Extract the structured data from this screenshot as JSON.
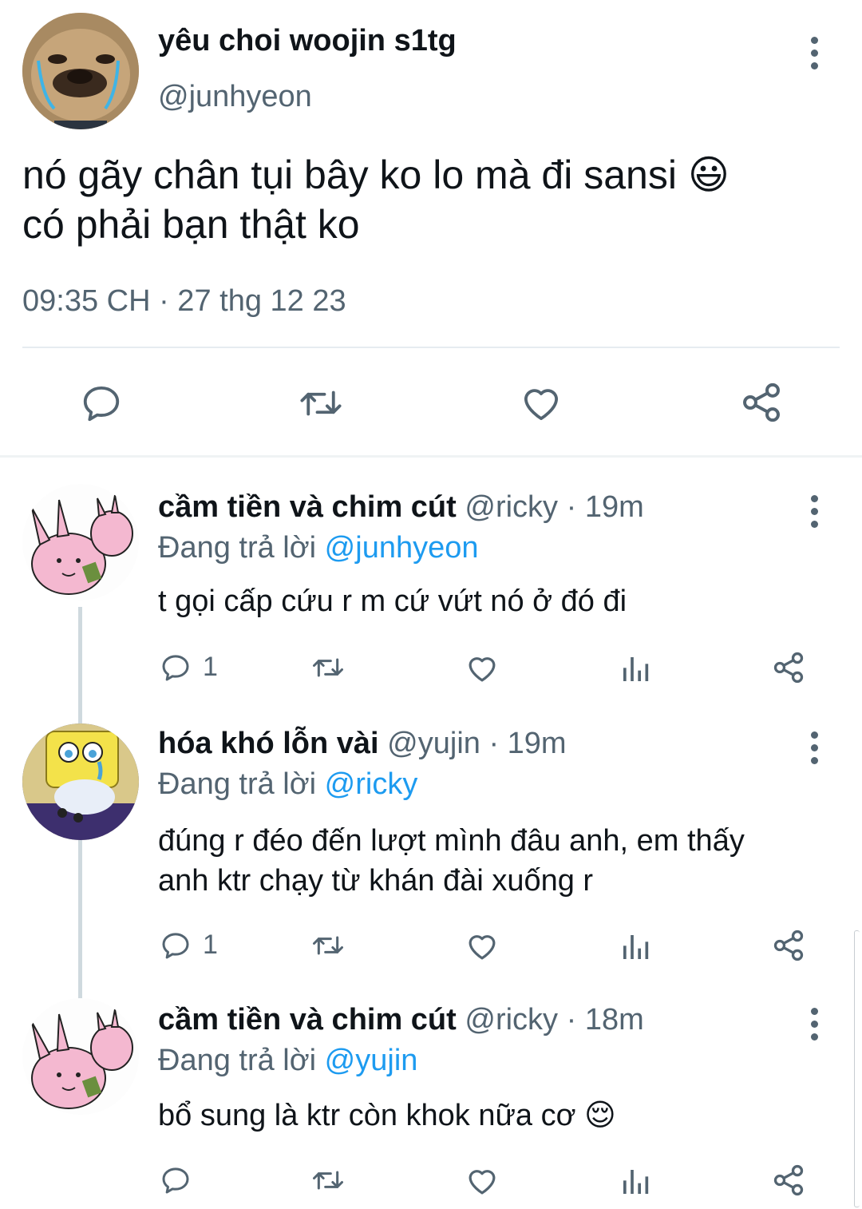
{
  "colors": {
    "text": "#0f1419",
    "secondary": "#536471",
    "link": "#1d9bf0",
    "divider": "#e6ecf0"
  },
  "main_tweet": {
    "display_name": "yêu choi woojin s1tg",
    "handle": "@junhyeon",
    "text_line1": "nó gãy chân tụi bây ko lo mà đi sansi",
    "emoji": "😃",
    "text_line2": "có phải bạn thật ko",
    "timestamp": "09:35 CH · 27 thg 12 23",
    "actions": [
      "reply-icon",
      "retweet-icon",
      "like-icon",
      "share-icon"
    ]
  },
  "replies": [
    {
      "display_name": "cầm tiền và chim cút",
      "meta": "@ricky · 19m",
      "replying_label": "Đang trả lời",
      "replying_to": "@junhyeon",
      "text": "t gọi cấp cứu r m cứ vứt nó ở đó đi",
      "reply_count": "1"
    },
    {
      "display_name": "hóa khó lỗn vài",
      "meta": "@yujin · 19m",
      "replying_label": "Đang trả lời",
      "replying_to": "@ricky",
      "text_line1": "đúng r đéo đến lượt mình đâu anh, em thấy",
      "text_line2": "anh ktr chạy từ khán đài xuống r",
      "reply_count": "1"
    },
    {
      "display_name": "cầm tiền và chim cút",
      "meta": "@ricky · 18m",
      "replying_label": "Đang trả lời",
      "replying_to": "@yujin",
      "text": "bổ sung là ktr còn khok nữa cơ",
      "emoji": "😌",
      "reply_count": ""
    }
  ]
}
